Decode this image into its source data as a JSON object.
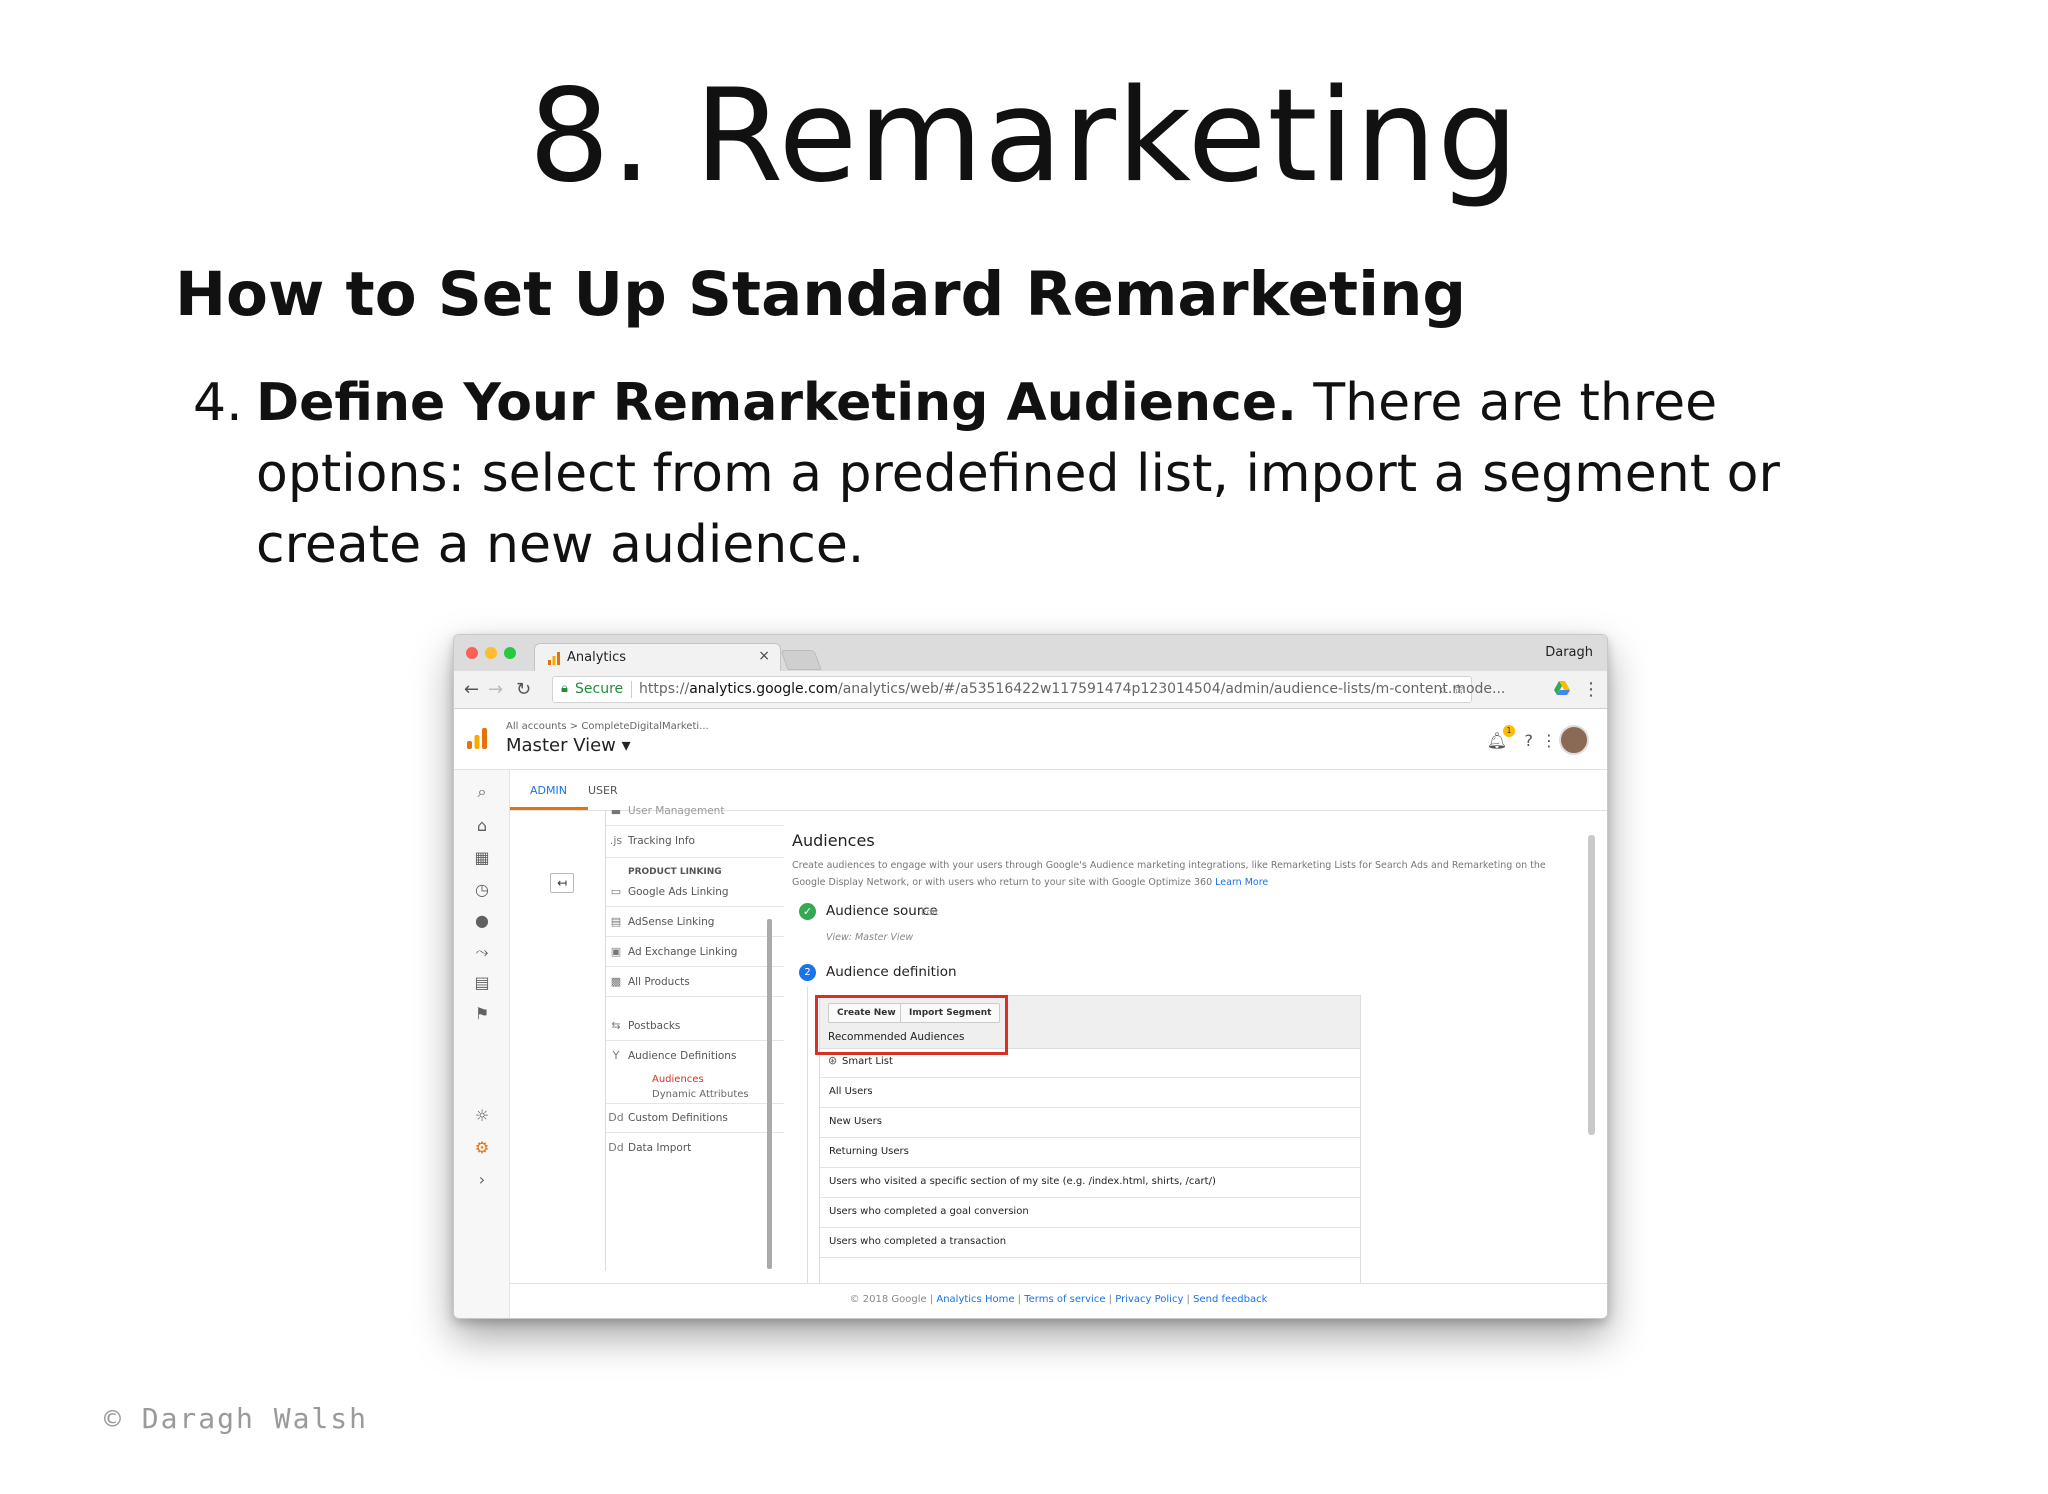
{
  "slide": {
    "title": "8. Remarketing",
    "subheading": "How to Set Up Standard Remarketing",
    "step_number": "4.",
    "step_bold": "Define Your Remarketing Audience.",
    "step_text": " There are three options: select from a predefined list, import a segment or create a new audience.",
    "copyright": "© Daragh Walsh"
  },
  "browser": {
    "tab_title": "Analytics",
    "tab_close": "×",
    "profile": "Daragh",
    "secure_label": "Secure",
    "url_prefix": "https://",
    "url_host": "analytics.google.com",
    "url_path": "/analytics/web/#/a53516422w117591474p123014504/admin/audience-lists/m-content.mode..."
  },
  "ga_header": {
    "breadcrumb": "All accounts > CompleteDigitalMarketi...",
    "view_name": "Master View ▾",
    "notification_count": "1"
  },
  "admin_tabs": [
    "ADMIN",
    "USER"
  ],
  "nav": {
    "user_management": "User Management",
    "tracking_info": "Tracking Info",
    "section_head": "PRODUCT LINKING",
    "items": [
      "Google Ads Linking",
      "AdSense Linking",
      "Ad Exchange Linking",
      "All Products",
      "Postbacks",
      "Audience Definitions"
    ],
    "sub_items": [
      "Audiences",
      "Dynamic Attributes"
    ],
    "items2": [
      "Custom Definitions",
      "Data Import"
    ]
  },
  "content": {
    "title": "Audiences",
    "description": "Create audiences to engage with your users through Google's Audience marketing integrations, like Remarketing Lists for Search Ads and Remarketing on the Google Display Network, or with users who return to your site with Google Optimize 360",
    "learn_more": "Learn More",
    "source_title": "Audience source",
    "edit": "Edit",
    "source_view": "View: Master View",
    "definition_title": "Audience definition",
    "step2_num": "2",
    "btn_create": "Create New",
    "btn_import": "Import Segment",
    "recommended": "Recommended Audiences",
    "rows": [
      "Smart List",
      "All Users",
      "New Users",
      "Returning Users",
      "Users who visited a specific section of my site (e.g. /index.html, shirts, /cart/)",
      "Users who completed a goal conversion",
      "Users who completed a transaction"
    ]
  },
  "footer": {
    "copyright": "© 2018 Google | ",
    "links": [
      "Analytics Home",
      "Terms of service",
      "Privacy Policy",
      "Send feedback"
    ]
  },
  "colors": {
    "accent_red": "#d93025",
    "ga_orange": "#e8710a",
    "link_blue": "#1a73e8",
    "ok_green": "#34a853"
  }
}
